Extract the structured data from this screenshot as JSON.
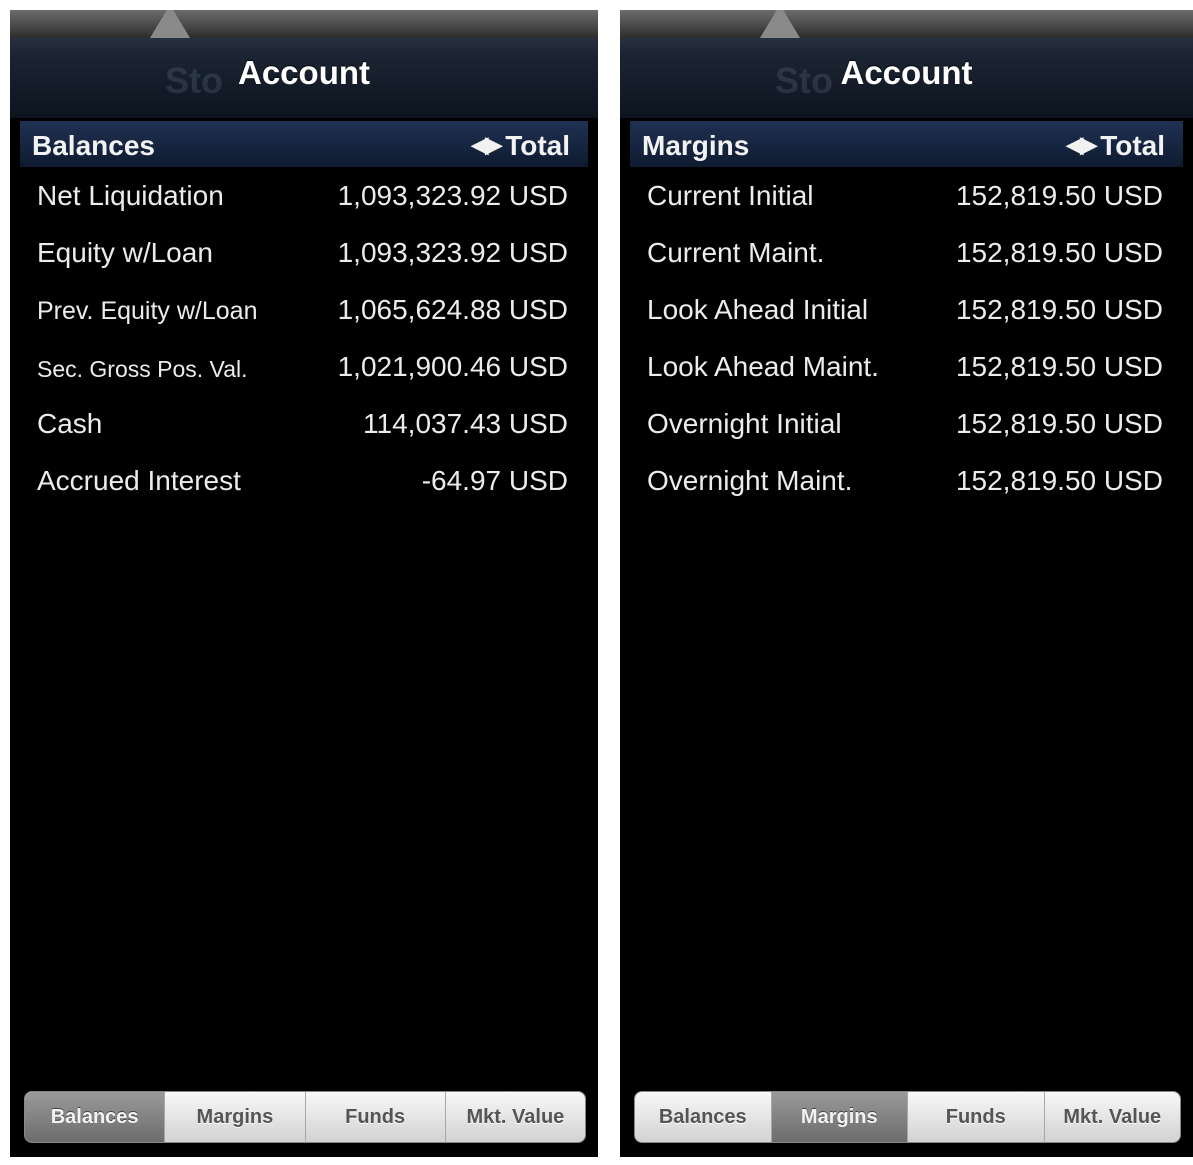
{
  "panels": [
    {
      "title": "Account",
      "ghost_text": "Sto",
      "section": "Balances",
      "sort_label": "Total",
      "rows": [
        {
          "label": "Net Liquidation",
          "value": "1,093,323.92 USD"
        },
        {
          "label": "Equity w/Loan",
          "value": "1,093,323.92 USD"
        },
        {
          "label": "Prev. Equity w/Loan",
          "value": "1,065,624.88 USD"
        },
        {
          "label": "Sec. Gross Pos. Val.",
          "value": "1,021,900.46 USD"
        },
        {
          "label": "Cash",
          "value": "114,037.43 USD"
        },
        {
          "label": "Accrued Interest",
          "value": "-64.97 USD"
        }
      ],
      "tabs": [
        "Balances",
        "Margins",
        "Funds",
        "Mkt. Value"
      ],
      "active_tab": "Balances"
    },
    {
      "title": "Account",
      "ghost_text": "Sto",
      "section": "Margins",
      "sort_label": "Total",
      "rows": [
        {
          "label": "Current Initial",
          "value": "152,819.50 USD"
        },
        {
          "label": "Current Maint.",
          "value": "152,819.50 USD"
        },
        {
          "label": "Look Ahead Initial",
          "value": "152,819.50 USD"
        },
        {
          "label": "Look Ahead Maint.",
          "value": "152,819.50 USD"
        },
        {
          "label": "Overnight Initial",
          "value": "152,819.50 USD"
        },
        {
          "label": "Overnight Maint.",
          "value": "152,819.50 USD"
        }
      ],
      "tabs": [
        "Balances",
        "Margins",
        "Funds",
        "Mkt. Value"
      ],
      "active_tab": "Margins"
    }
  ],
  "icons": {
    "sort": "left-right-arrows-icon"
  },
  "colors": {
    "header_blue": "#1f3152",
    "background": "#000000",
    "text": "#ececec"
  }
}
